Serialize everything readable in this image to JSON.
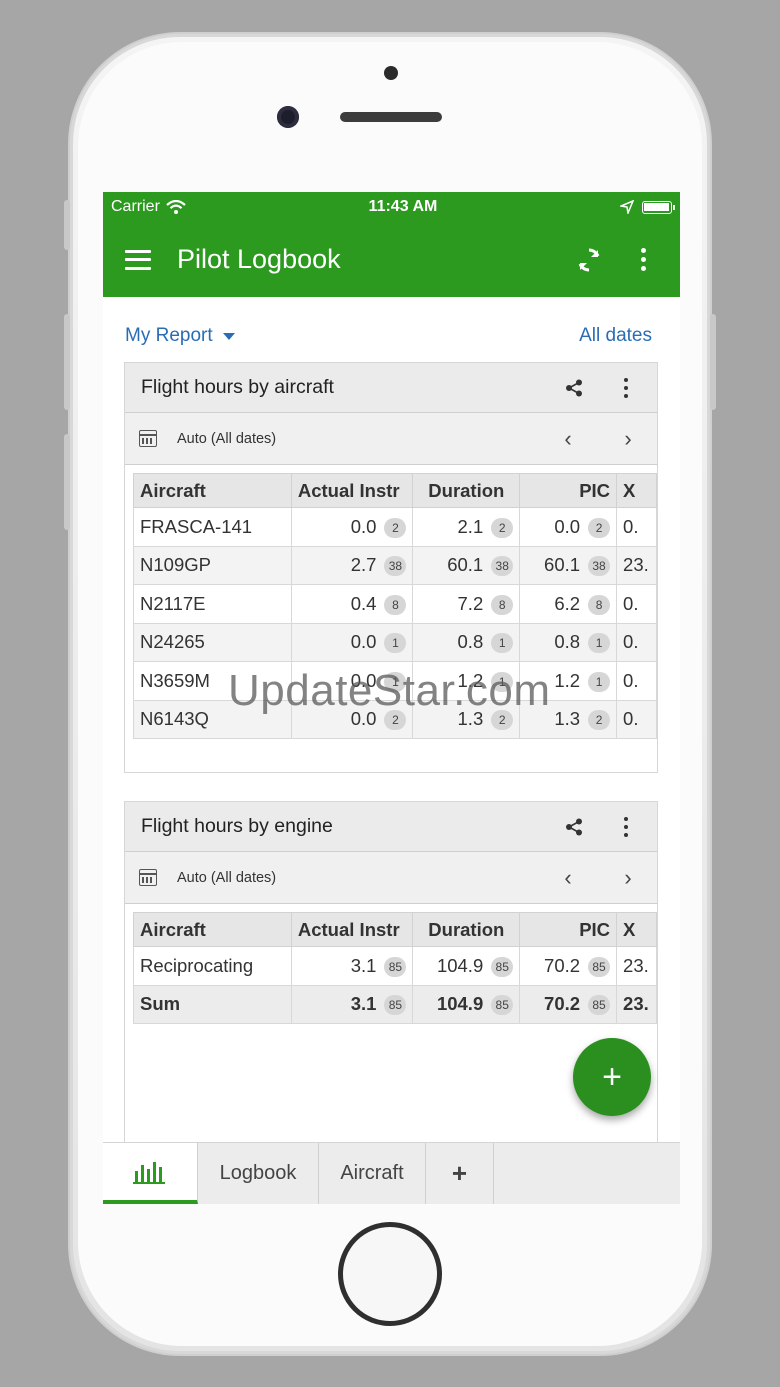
{
  "status_bar": {
    "carrier": "Carrier",
    "time": "11:43 AM"
  },
  "app_bar": {
    "title": "Pilot Logbook"
  },
  "report_bar": {
    "report_name": "My Report",
    "date_filter": "All dates"
  },
  "cards": [
    {
      "title": "Flight hours by aircraft",
      "date_label": "Auto (All dates)",
      "columns": [
        "Aircraft",
        "Actual Instr",
        "Duration",
        "PIC",
        "X"
      ],
      "rows": [
        {
          "aircraft": "FRASCA-141",
          "actual": "0.0",
          "actual_n": "2",
          "duration": "2.1",
          "duration_n": "2",
          "pic": "0.0",
          "pic_n": "2",
          "x": "0."
        },
        {
          "aircraft": "N109GP",
          "actual": "2.7",
          "actual_n": "38",
          "duration": "60.1",
          "duration_n": "38",
          "pic": "60.1",
          "pic_n": "38",
          "x": "23."
        },
        {
          "aircraft": "N2117E",
          "actual": "0.4",
          "actual_n": "8",
          "duration": "7.2",
          "duration_n": "8",
          "pic": "6.2",
          "pic_n": "8",
          "x": "0."
        },
        {
          "aircraft": "N24265",
          "actual": "0.0",
          "actual_n": "1",
          "duration": "0.8",
          "duration_n": "1",
          "pic": "0.8",
          "pic_n": "1",
          "x": "0."
        },
        {
          "aircraft": "N3659M",
          "actual": "0.0",
          "actual_n": "1",
          "duration": "1.2",
          "duration_n": "1",
          "pic": "1.2",
          "pic_n": "1",
          "x": "0."
        },
        {
          "aircraft": "N6143Q",
          "actual": "0.0",
          "actual_n": "2",
          "duration": "1.3",
          "duration_n": "2",
          "pic": "1.3",
          "pic_n": "2",
          "x": "0."
        }
      ]
    },
    {
      "title": "Flight hours by engine",
      "date_label": "Auto (All dates)",
      "columns": [
        "Aircraft",
        "Actual Instr",
        "Duration",
        "PIC",
        "X"
      ],
      "rows": [
        {
          "aircraft": "Reciprocating",
          "actual": "3.1",
          "actual_n": "85",
          "duration": "104.9",
          "duration_n": "85",
          "pic": "70.2",
          "pic_n": "85",
          "x": "23."
        }
      ],
      "sum": {
        "aircraft": "Sum",
        "actual": "3.1",
        "actual_n": "85",
        "duration": "104.9",
        "duration_n": "85",
        "pic": "70.2",
        "pic_n": "85",
        "x": "23."
      }
    }
  ],
  "tabs": [
    {
      "icon": "bar-chart-icon",
      "label": ""
    },
    {
      "label": "Logbook"
    },
    {
      "label": "Aircraft"
    },
    {
      "icon": "plus-icon",
      "label": "+"
    }
  ],
  "fab": {
    "symbol": "+"
  },
  "watermark": "UpdateStar.com",
  "colors": {
    "primary": "#2c9a1f",
    "link": "#2a6db5",
    "fab": "#2a8f1f"
  }
}
